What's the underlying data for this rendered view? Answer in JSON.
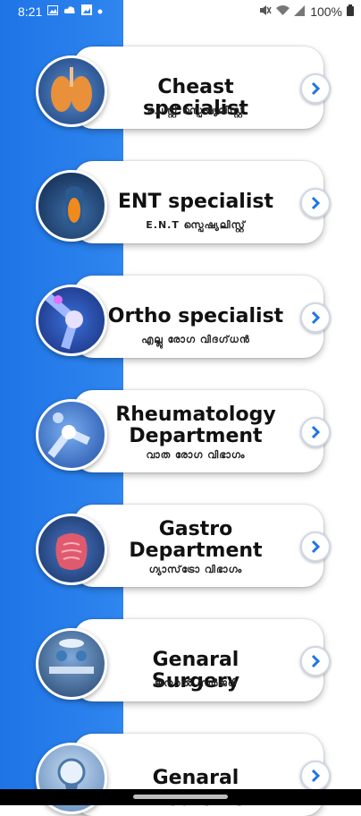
{
  "status_bar": {
    "time": "8:21",
    "battery": "100%",
    "icons_left": [
      "image-icon",
      "cloud-icon",
      "photo-icon",
      "dot-icon"
    ],
    "icons_right": [
      "mute-icon",
      "wifi-icon",
      "signal-icon",
      "battery-icon"
    ]
  },
  "colors": {
    "accent": "#2f86ef",
    "card_bg": "#ffffff",
    "arrow": "#1e74e6"
  },
  "departments": [
    {
      "title_lines": [
        "Cheast specialist"
      ],
      "subtitle": "ചെസ്റ്റ് സ്പെഷ്യലിസ്റ്റ്",
      "icon": "lungs-icon"
    },
    {
      "title_lines": [
        "ENT specialist"
      ],
      "subtitle": "E.N.T സ്പെഷ്യലിസ്റ്റ്",
      "icon": "throat-icon"
    },
    {
      "title_lines": [
        "Ortho specialist"
      ],
      "subtitle": "എല്ലു രോഗ വിദഗ്‌ധൻ",
      "icon": "knee-icon"
    },
    {
      "title_lines": [
        "Rheumatology",
        "Department"
      ],
      "subtitle": "വാത രോഗ വിഭാഗം",
      "icon": "joints-icon"
    },
    {
      "title_lines": [
        "Gastro",
        "Department"
      ],
      "subtitle": "ഗ്യാസ്‌ട്രോ വിഭാഗം",
      "icon": "intestine-icon"
    },
    {
      "title_lines": [
        "Genaral Surgery"
      ],
      "subtitle": "ജനറൽ സർജറി",
      "icon": "surgery-icon"
    },
    {
      "title_lines": [
        "Genaral Medicine"
      ],
      "subtitle": "",
      "icon": "medicine-icon"
    }
  ]
}
